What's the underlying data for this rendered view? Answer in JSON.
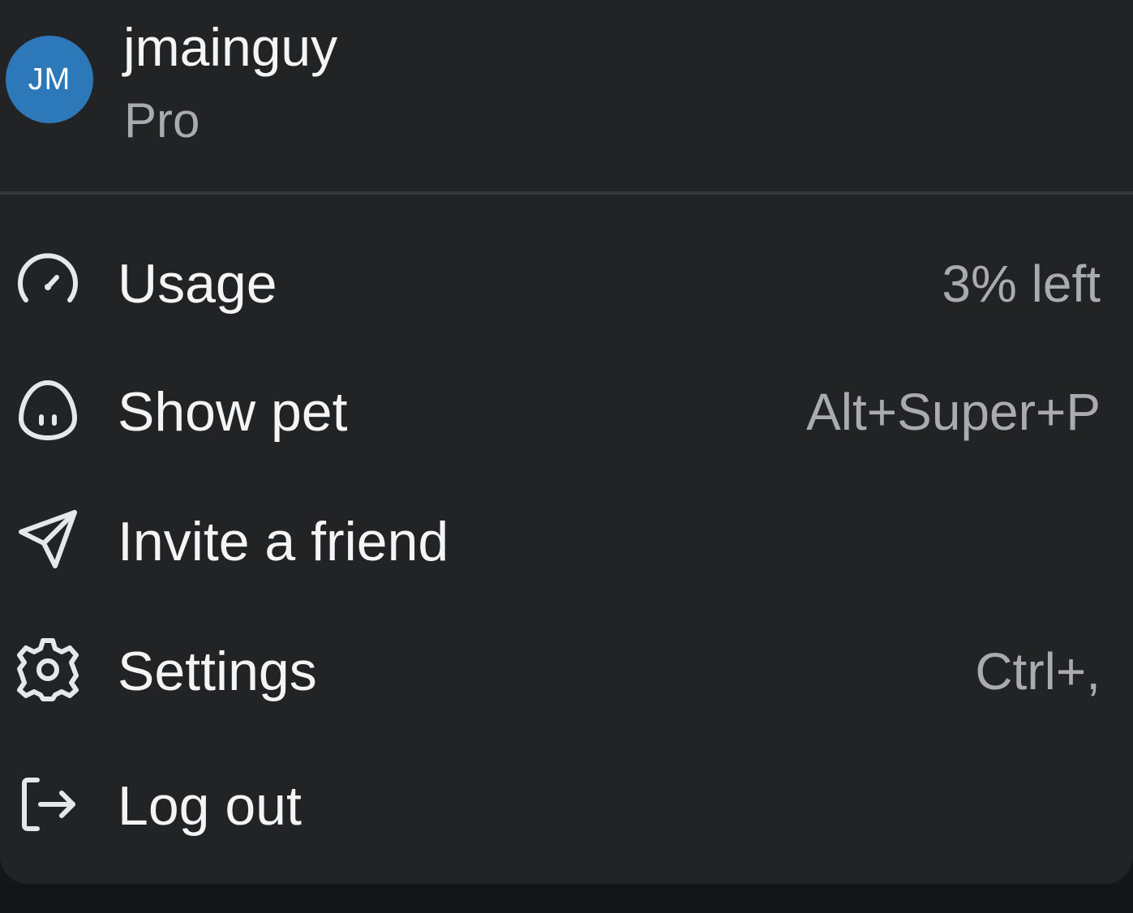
{
  "theme": {
    "menu_bg": "#222325",
    "text_primary": "#f4f4f5",
    "text_secondary": "#a9abb0",
    "avatar_bg": "#2c78b8"
  },
  "account": {
    "initials": "JM",
    "username": "jmainguy",
    "plan": "Pro"
  },
  "menu": {
    "items": [
      {
        "label": "Usage",
        "icon": "gauge-icon",
        "shortcut": "3% left"
      },
      {
        "label": "Show pet",
        "icon": "pet-icon",
        "shortcut": "Alt+Super+P"
      },
      {
        "label": "Invite a friend",
        "icon": "send-icon",
        "shortcut": ""
      },
      {
        "label": "Settings",
        "icon": "gear-icon",
        "shortcut": "Ctrl+,"
      },
      {
        "label": "Log out",
        "icon": "logout-icon",
        "shortcut": ""
      }
    ]
  }
}
